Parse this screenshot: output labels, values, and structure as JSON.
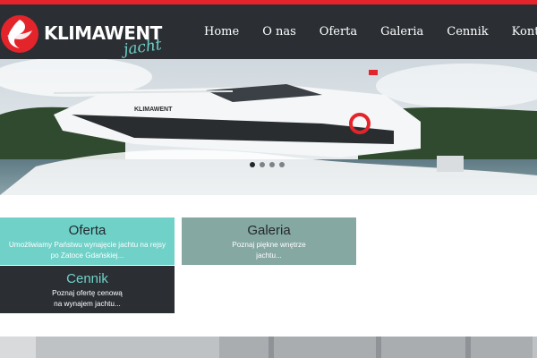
{
  "brand": {
    "name": "KLIMAWENT",
    "sub": "jacht",
    "accent": "#e4242b",
    "teal": "#6fd1c8",
    "dark": "#2b2f34"
  },
  "nav": {
    "items": [
      {
        "label": "Home"
      },
      {
        "label": "O nas"
      },
      {
        "label": "Oferta"
      },
      {
        "label": "Galeria"
      },
      {
        "label": "Cennik"
      },
      {
        "label": "Kontakt"
      }
    ]
  },
  "hero": {
    "boat_name": "KLIMAWENT",
    "slides": 4,
    "active_slide": 1
  },
  "tiles": {
    "oferta": {
      "title": "Oferta",
      "desc_line1": "Umożliwiamy Państwu wynajęcie jachtu na rejsy",
      "desc_line2": "po Zatoce Gdańskiej..."
    },
    "galeria": {
      "title": "Galeria",
      "desc_line1": "Poznaj piękne wnętrze",
      "desc_line2": "jachtu..."
    },
    "cennik": {
      "title": "Cennik",
      "desc_line1": "Poznaj ofertę cenową",
      "desc_line2": "na wynajem jachtu..."
    }
  }
}
